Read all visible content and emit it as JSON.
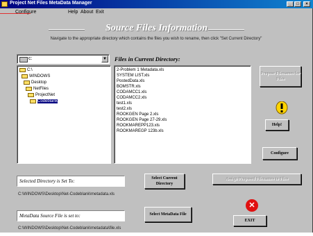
{
  "window": {
    "title": "Project Net Files MetaData Manager",
    "controls": {
      "minimize": "_",
      "maximize": "□",
      "close": "×"
    }
  },
  "menu": {
    "items": [
      "Configure",
      "Help",
      "About",
      "Exit"
    ]
  },
  "header": {
    "title": "Source Files Information",
    "instruction": "Navigate to the appropriate directory which contains the files you wish to rename, then click \"Set Current Directory\""
  },
  "drive": {
    "value": "c:"
  },
  "tree": {
    "items": [
      "C:\\",
      "WINDOWS",
      "Desktop",
      "NetFiles",
      "ProjectNet",
      "Codeblank"
    ],
    "selected": "Codeblank"
  },
  "files": {
    "label": "Files in Current Directory:",
    "items": [
      "2-Problem 1 Metadata.xls",
      "SYSTEM LIST.xls",
      "PostedData.xls",
      "BOMSTR.xls",
      "CODAMCC1.xls",
      "CODAMCC2.xls",
      "test1.xls",
      "test2.xls",
      "ROOKGEN Page 2.xls",
      "ROOKGEN Page 27-29.xls",
      "ROOKMAREPP123.xls",
      "ROOKMAREGP 123b.xls"
    ]
  },
  "buttons": {
    "propose": "Propose Filenames for Files",
    "help": "Help!",
    "configure": "Configure",
    "set_dir": "Select Current Directory",
    "rename": "Assign Proposed Filenames to Files",
    "select_file": "Select MetaData File",
    "exit": "EXIT"
  },
  "status": {
    "dir_label": "Selected Directory is Set To:",
    "dir_path": "C:\\WINDOWS\\Desktop\\Net-Codeblank\\metadata.xls",
    "meta_label": "MetaData Source File is set to:",
    "meta_path": "C:\\WINDOWS\\Desktop\\Net-Codeblank\\metadata\\file.xls"
  },
  "colors": {
    "titlebar": "#000080",
    "face": "#c0c0c0",
    "warning": "#ffd400",
    "error": "#e01010"
  }
}
